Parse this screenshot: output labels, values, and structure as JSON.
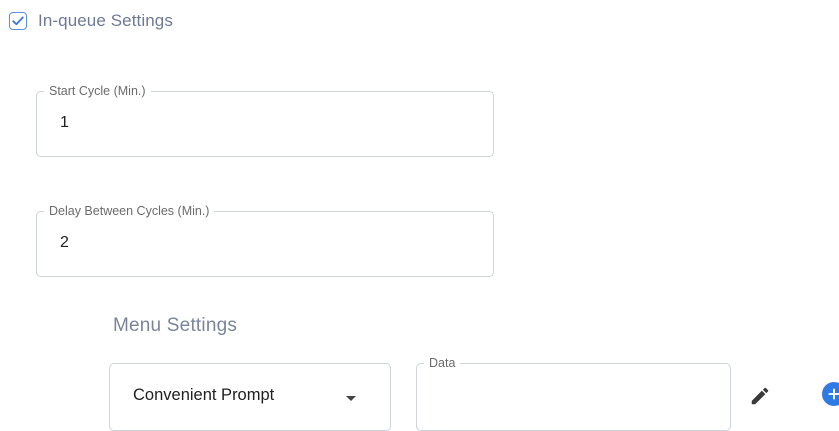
{
  "inqueue": {
    "label": "In-queue Settings",
    "checked": true,
    "icon": "checkbox-checked-icon"
  },
  "start_cycle": {
    "label": "Start Cycle (Min.)",
    "value": "1"
  },
  "delay_between_cycles": {
    "label": "Delay Between Cycles (Min.)",
    "value": "2"
  },
  "menu_settings": {
    "title": "Menu Settings",
    "prompt_select": {
      "value": "Convenient Prompt",
      "icon": "dropdown-caret-icon"
    },
    "data_field": {
      "label": "Data",
      "value": ""
    },
    "edit_icon": "pencil-icon",
    "add_icon": "plus-circle-icon"
  },
  "colors": {
    "accent": "#2f7be5",
    "checkbox_border": "#5b8fd8",
    "muted_text": "#6e7a93",
    "field_border": "#cfd3da"
  }
}
